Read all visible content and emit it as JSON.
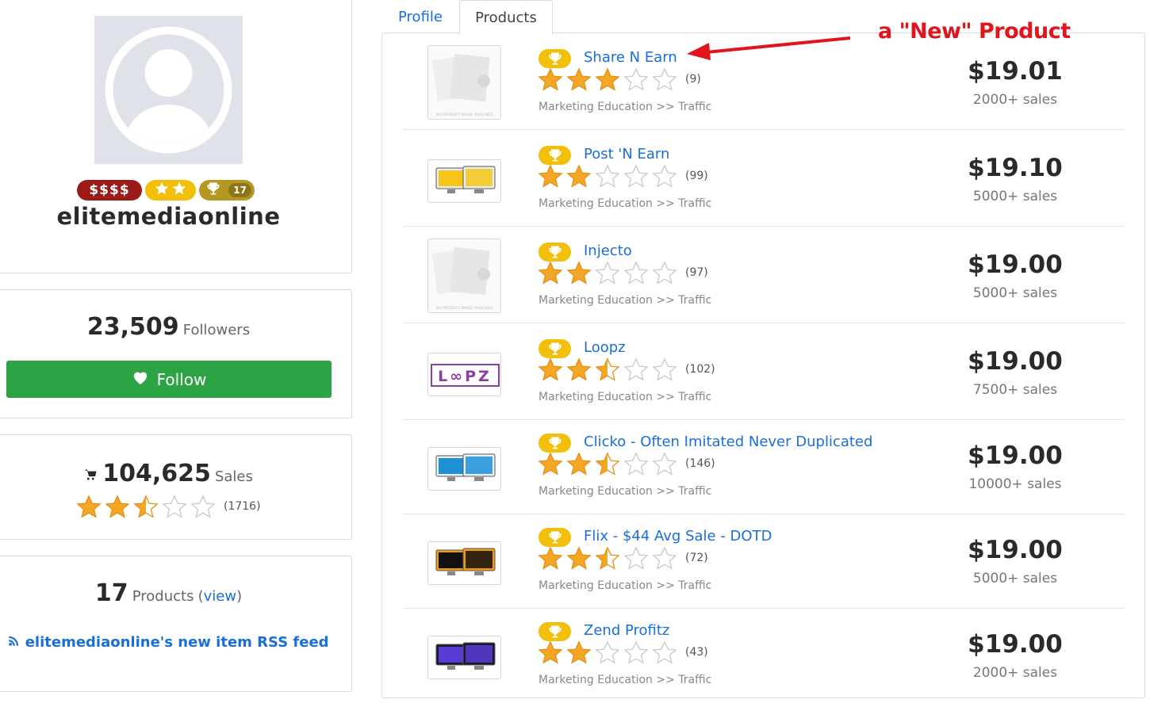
{
  "profile": {
    "badge_money": "$$$$",
    "badge_award_count": "17",
    "username": "elitemediaonline"
  },
  "followers": {
    "count": "23,509",
    "label": "Followers",
    "follow_label": "Follow"
  },
  "sales": {
    "count": "104,625",
    "label": "Sales",
    "rating": 2.5,
    "reviews": "(1716)"
  },
  "products_summary": {
    "count": "17",
    "label": "Products",
    "open_paren": "(",
    "view_label": "view",
    "close_paren": ")",
    "rss_label": "elitemediaonline's new item RSS feed"
  },
  "tabs": [
    {
      "label": "Profile"
    },
    {
      "label": "Products"
    }
  ],
  "annotation": "a \"New\" Product",
  "products": [
    {
      "title": "Share N Earn",
      "rating": 3,
      "reviews": "(9)",
      "category": "Marketing Education >> Traffic",
      "price": "$19.01",
      "sales": "2000+ sales",
      "thumb": "no-image"
    },
    {
      "title": "Post 'N Earn",
      "rating": 2,
      "reviews": "(99)",
      "category": "Marketing Education >> Traffic",
      "price": "$19.10",
      "sales": "5000+ sales",
      "thumb": "yellow-monitor"
    },
    {
      "title": "Injecto",
      "rating": 2,
      "reviews": "(97)",
      "category": "Marketing Education >> Traffic",
      "price": "$19.00",
      "sales": "5000+ sales",
      "thumb": "no-image"
    },
    {
      "title": "Loopz",
      "rating": 2.5,
      "reviews": "(102)",
      "category": "Marketing Education >> Traffic",
      "price": "$19.00",
      "sales": "7500+ sales",
      "thumb": "loopz-logo"
    },
    {
      "title": "Clicko - Often Imitated Never Duplicated",
      "rating": 2.5,
      "reviews": "(146)",
      "category": "Marketing Education >> Traffic",
      "price": "$19.00",
      "sales": "10000+ sales",
      "thumb": "blue-monitor"
    },
    {
      "title": "Flix - $44 Avg Sale - DOTD",
      "rating": 2.5,
      "reviews": "(72)",
      "category": "Marketing Education >> Traffic",
      "price": "$19.00",
      "sales": "5000+ sales",
      "thumb": "dark-devices"
    },
    {
      "title": "Zend Profitz",
      "rating": 2,
      "reviews": "(43)",
      "category": "Marketing Education >> Traffic",
      "price": "$19.00",
      "sales": "2000+ sales",
      "thumb": "purple-monitor"
    }
  ],
  "colors": {
    "link": "#1a6ed8",
    "follow": "#2ca344",
    "star": "#f5a623",
    "badge_gold": "#f2c00a",
    "money": "#9b1b1b",
    "annotation": "#e0151d"
  }
}
